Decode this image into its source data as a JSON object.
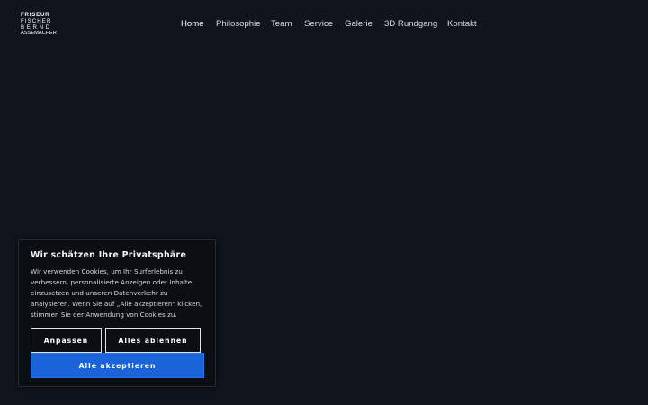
{
  "logo": {
    "line1": "FRISEUR",
    "line2": "FISCHER",
    "line3": "BERND",
    "line4": "ASSEMACHER"
  },
  "nav": {
    "items": [
      {
        "label": "Home",
        "active": true
      },
      {
        "label": "Philosophie",
        "active": false
      },
      {
        "label": "Team",
        "active": false
      },
      {
        "label": "Service",
        "active": false
      },
      {
        "label": "Galerie",
        "active": false
      },
      {
        "label": "3D Rundgang",
        "active": false
      },
      {
        "label": "Kontakt",
        "active": false
      }
    ]
  },
  "cookie_banner": {
    "title": "Wir schätzen Ihre Privatsphäre",
    "text": "Wir verwenden Cookies, um Ihr Surferlebnis zu verbessern, personalisierte Anzeigen oder Inhalte einzusetzen und unseren Datenverkehr zu analysieren. Wenn Sie auf „Alle akzeptieren\" klicken, stimmen Sie der Anwendung von Cookies zu.",
    "customize_label": "Anpassen",
    "reject_label": "Alles ablehnen",
    "accept_label": "Alle akzeptieren"
  },
  "colors": {
    "background": "#10141c",
    "accent": "#1b63d8"
  }
}
